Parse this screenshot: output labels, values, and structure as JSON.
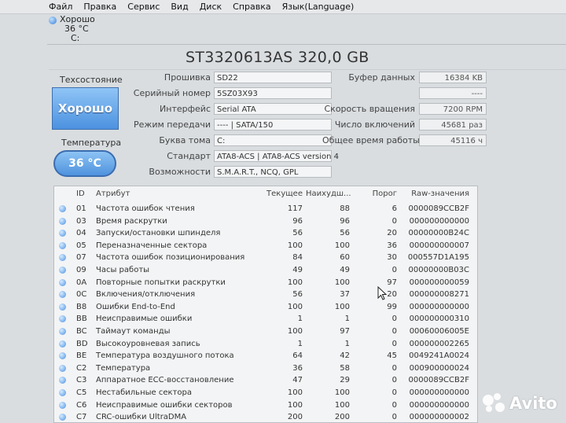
{
  "menu": [
    "Файл",
    "Правка",
    "Сервис",
    "Вид",
    "Диск",
    "Справка",
    "Язык(Language)"
  ],
  "drive_tab": {
    "status": "Хорошо",
    "temp": "36 °C",
    "letter": "C:"
  },
  "title": "ST3320613AS 320,0 GB",
  "health": {
    "label": "Техсостояние",
    "value": "Хорошо"
  },
  "temperature": {
    "label": "Температура",
    "value": "36 °C"
  },
  "info_left": [
    {
      "label": "Прошивка",
      "value": "SD22"
    },
    {
      "label": "Серийный номер",
      "value": "5SZ03X93"
    },
    {
      "label": "Интерфейс",
      "value": "Serial ATA"
    },
    {
      "label": "Режим передачи",
      "value": "---- | SATA/150"
    },
    {
      "label": "Буква тома",
      "value": "C:"
    },
    {
      "label": "Стандарт",
      "value": "ATA8-ACS | ATA8-ACS version 4"
    },
    {
      "label": "Возможности",
      "value": "S.M.A.R.T., NCQ, GPL"
    }
  ],
  "info_right": [
    {
      "label": "Буфер данных",
      "value": "16384 KB"
    },
    {
      "label": "",
      "value": "----"
    },
    {
      "label": "Скорость вращения",
      "value": "7200 RPM"
    },
    {
      "label": "Число включений",
      "value": "45681 раз"
    },
    {
      "label": "Общее время работы",
      "value": "45116 ч"
    }
  ],
  "table": {
    "headers": {
      "id": "ID",
      "attr": "Атрибут",
      "cur": "Текущее",
      "worst": "Наихудш...",
      "thr": "Порог",
      "raw": "Raw-значения"
    },
    "rows": [
      {
        "id": "01",
        "attr": "Частота ошибок чтения",
        "cur": "117",
        "worst": "88",
        "thr": "6",
        "raw": "0000089CCB2F"
      },
      {
        "id": "03",
        "attr": "Время раскрутки",
        "cur": "96",
        "worst": "96",
        "thr": "0",
        "raw": "000000000000"
      },
      {
        "id": "04",
        "attr": "Запуски/остановки шпинделя",
        "cur": "56",
        "worst": "56",
        "thr": "20",
        "raw": "00000000B24C"
      },
      {
        "id": "05",
        "attr": "Переназначенные сектора",
        "cur": "100",
        "worst": "100",
        "thr": "36",
        "raw": "000000000007"
      },
      {
        "id": "07",
        "attr": "Частота ошибок позиционирования",
        "cur": "84",
        "worst": "60",
        "thr": "30",
        "raw": "000557D1A195"
      },
      {
        "id": "09",
        "attr": "Часы работы",
        "cur": "49",
        "worst": "49",
        "thr": "0",
        "raw": "00000000B03C"
      },
      {
        "id": "0A",
        "attr": "Повторные попытки раскрутки",
        "cur": "100",
        "worst": "100",
        "thr": "97",
        "raw": "000000000059"
      },
      {
        "id": "0C",
        "attr": "Включения/отключения",
        "cur": "56",
        "worst": "37",
        "thr": "20",
        "raw": "000000008271"
      },
      {
        "id": "B8",
        "attr": "Ошибки End-to-End",
        "cur": "100",
        "worst": "100",
        "thr": "99",
        "raw": "000000000000"
      },
      {
        "id": "BB",
        "attr": "Неисправимые ошибки",
        "cur": "1",
        "worst": "1",
        "thr": "0",
        "raw": "000000000310"
      },
      {
        "id": "BC",
        "attr": "Таймаут команды",
        "cur": "100",
        "worst": "97",
        "thr": "0",
        "raw": "00060006005E"
      },
      {
        "id": "BD",
        "attr": "Высокоуровневая запись",
        "cur": "1",
        "worst": "1",
        "thr": "0",
        "raw": "000000002265"
      },
      {
        "id": "BE",
        "attr": "Температура воздушного потока",
        "cur": "64",
        "worst": "42",
        "thr": "45",
        "raw": "0049241A0024"
      },
      {
        "id": "C2",
        "attr": "Температура",
        "cur": "36",
        "worst": "58",
        "thr": "0",
        "raw": "000900000024"
      },
      {
        "id": "C3",
        "attr": "Аппаратное ECC-восстановление",
        "cur": "47",
        "worst": "29",
        "thr": "0",
        "raw": "0000089CCB2F"
      },
      {
        "id": "C5",
        "attr": "Нестабильные сектора",
        "cur": "100",
        "worst": "100",
        "thr": "0",
        "raw": "000000000000"
      },
      {
        "id": "C6",
        "attr": "Неисправимые ошибки секторов",
        "cur": "100",
        "worst": "100",
        "thr": "0",
        "raw": "000000000000"
      },
      {
        "id": "C7",
        "attr": "CRC-ошибки UltraDMA",
        "cur": "200",
        "worst": "200",
        "thr": "0",
        "raw": "000000000002"
      }
    ]
  },
  "watermark": "Avito"
}
